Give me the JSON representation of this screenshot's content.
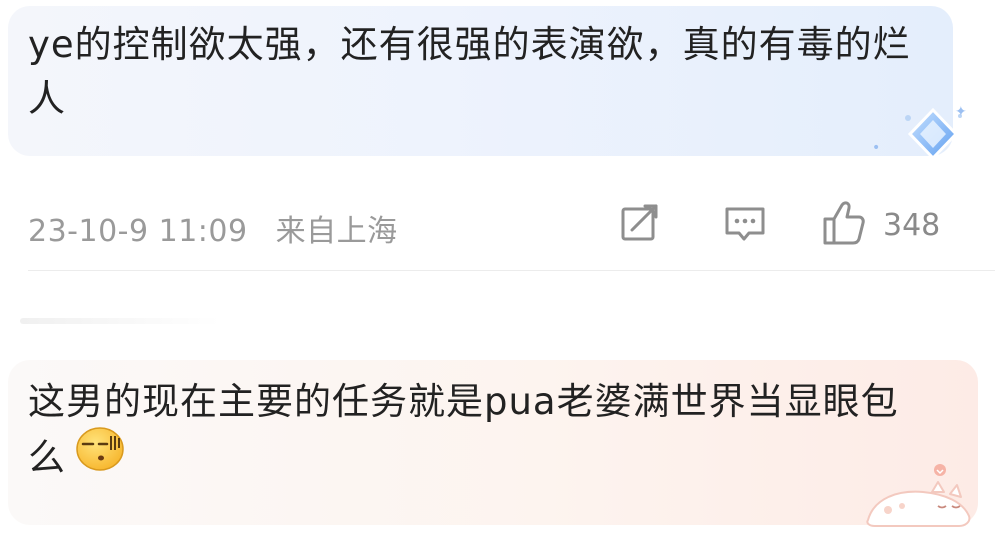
{
  "comments": [
    {
      "text": "ye的控制欲太强，还有很强的表演欲，真的有毒的烂人",
      "date": "23-10-9 11:09",
      "location": "来自上海",
      "like_count": "348"
    },
    {
      "text": "这男的现在主要的任务就是pua老婆满世界当显眼包么"
    }
  ],
  "icons": {
    "share": "share-edit-icon",
    "comment": "comment-icon",
    "like": "thumbs-up-icon",
    "badge": "diamond-badge-icon",
    "emoji": "awkward-face-emoji-icon",
    "decoration": "sleeping-cat-icon"
  },
  "colors": {
    "bubble_blue": "#e4eefc",
    "bubble_pink": "#fdebe6",
    "meta_gray": "#9a9a9a",
    "text": "#222222"
  }
}
